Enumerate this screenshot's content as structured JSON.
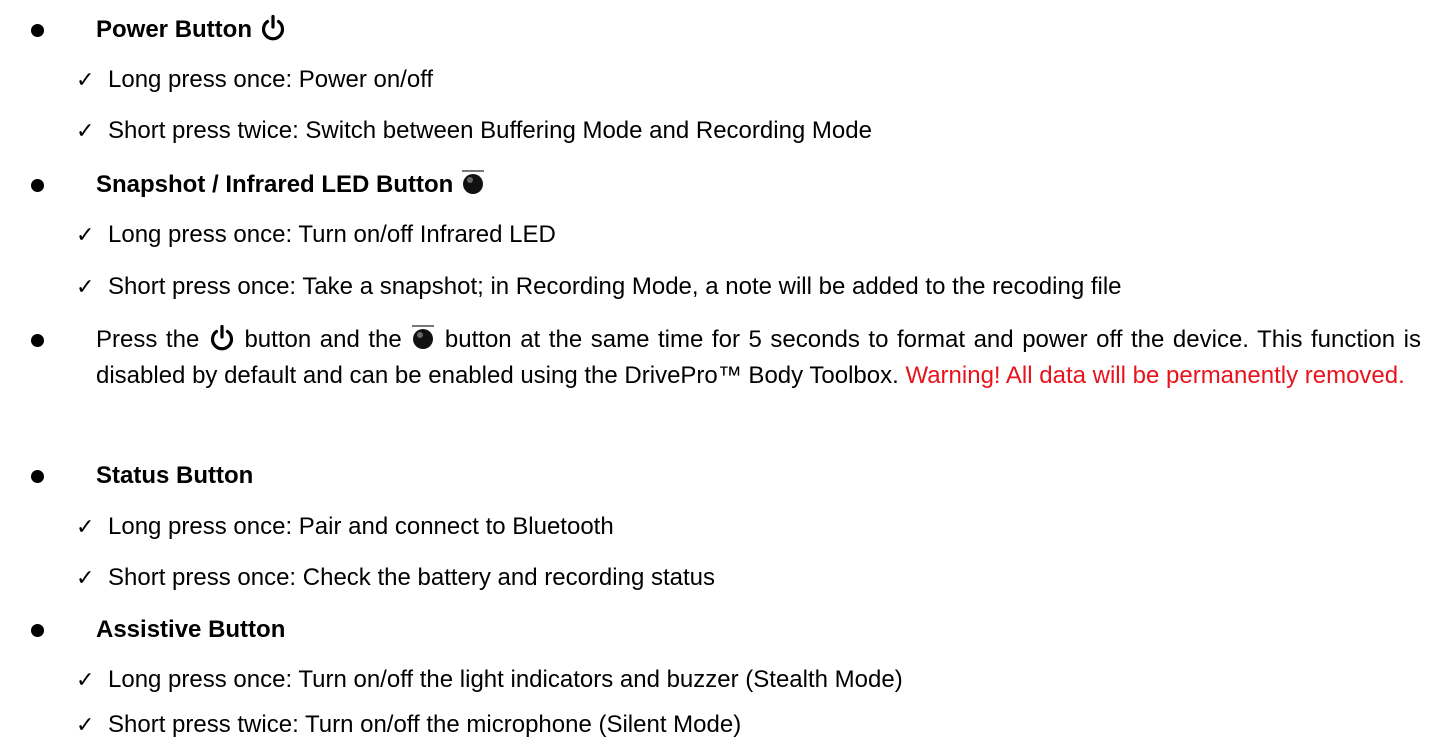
{
  "sections": {
    "power": {
      "heading": "Power Button",
      "icon": "power-icon",
      "lines": [
        "Long press once: Power on/off",
        "Short press twice: Switch between Buffering Mode and Recording Mode"
      ]
    },
    "snapshot": {
      "heading": "Snapshot / Infrared LED Button",
      "icon": "snapshot-button-icon",
      "lines": [
        "Long press once: Turn on/off Infrared LED",
        "Short press once: Take a snapshot; in Recording Mode, a note will be added to the recoding file"
      ]
    },
    "combo": {
      "text_a": "Press the",
      "text_b": "button and the",
      "text_c": "button at the same time for 5 seconds to format and power off the device. This function is disabled by default and can be enabled using the DrivePro™ Body Toolbox.",
      "warning": "Warning! All data will be permanently removed.",
      "warning_color": "#e8131c"
    },
    "status": {
      "heading": "Status Button",
      "lines": [
        "Long press once: Pair and connect to Bluetooth",
        "Short press once: Check the battery and recording status"
      ]
    },
    "assistive": {
      "heading": "Assistive Button",
      "lines": [
        "Long press once: Turn on/off the light indicators and buzzer (Stealth Mode)",
        "Short press twice: Turn on/off the microphone (Silent Mode)"
      ]
    }
  }
}
